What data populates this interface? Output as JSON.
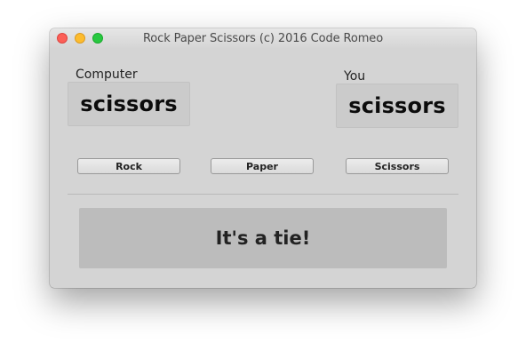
{
  "window": {
    "title": "Rock Paper Scissors (c) 2016 Code Romeo"
  },
  "computer": {
    "label": "Computer",
    "choice": "scissors"
  },
  "player": {
    "label": "You",
    "choice": "scissors"
  },
  "buttons": {
    "rock": "Rock",
    "paper": "Paper",
    "scissors": "Scissors"
  },
  "result": {
    "text": "It's a tie!"
  },
  "colors": {
    "close": "#fc5f57",
    "minimize": "#fdbc2e",
    "zoom": "#28c840",
    "window_bg": "#d4d4d4",
    "result_bg": "#bcbcbc"
  }
}
